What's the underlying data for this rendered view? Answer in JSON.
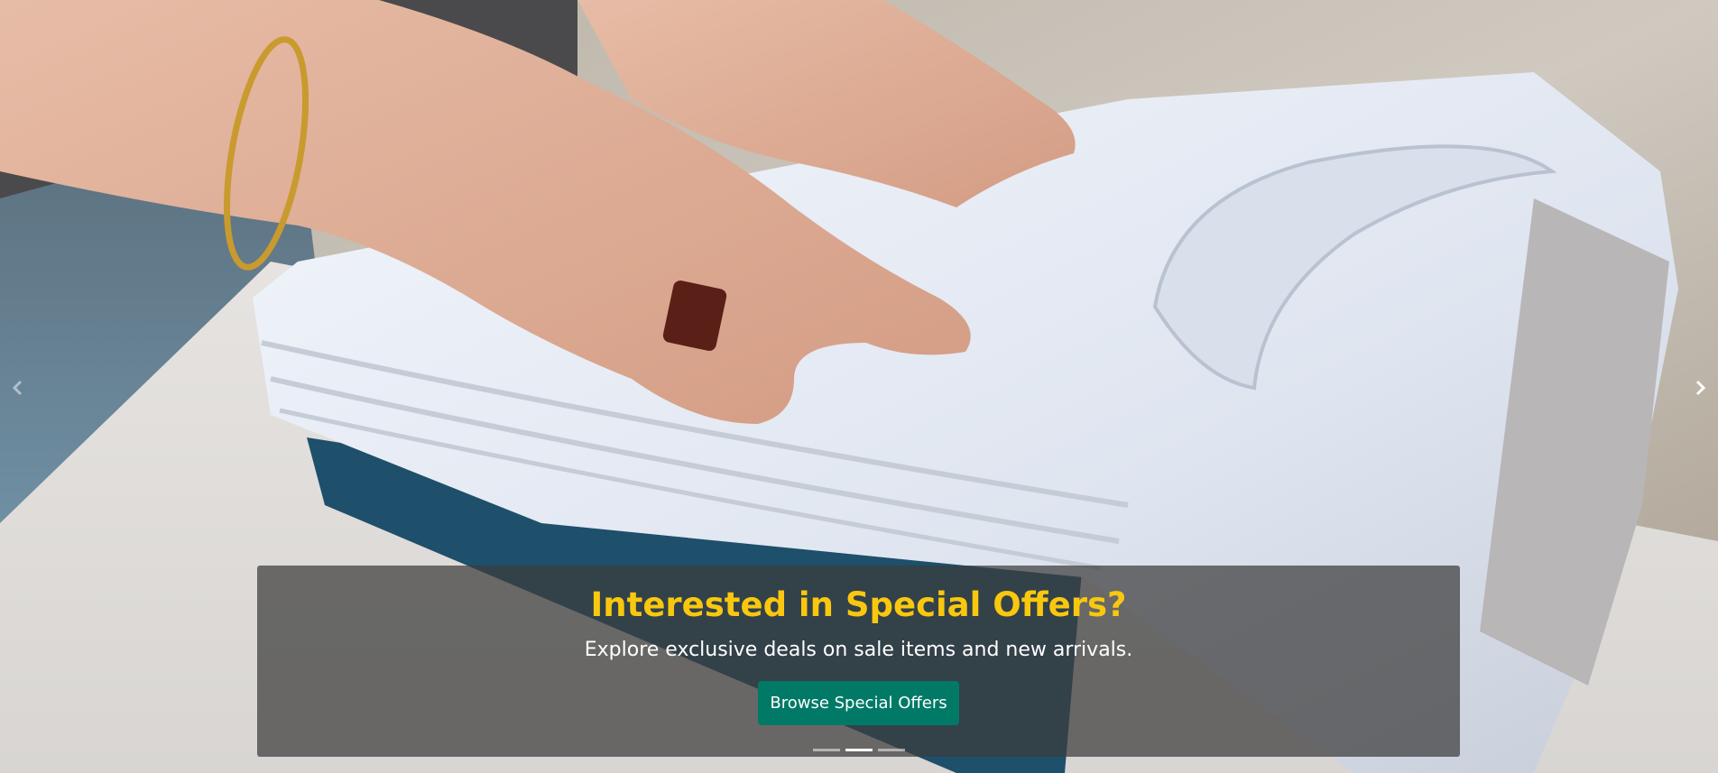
{
  "carousel": {
    "image_alt": "Hands folding a stack of white t-shirts",
    "prev_label": "Previous",
    "next_label": "Next",
    "indicators_count": 3,
    "active_indicator": 2
  },
  "caption": {
    "title": "Interested in Special Offers?",
    "text": "Explore exclusive deals on sale items and new arrivals.",
    "button_label": "Browse Special Offers"
  },
  "colors": {
    "title": "#f9c80e",
    "button": "#007a66",
    "caption_overlay": "rgba(60,60,60,0.72)"
  }
}
